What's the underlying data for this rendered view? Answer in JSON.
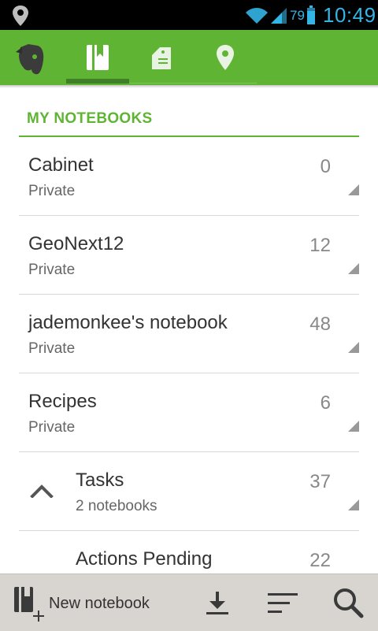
{
  "status_bar": {
    "battery_percent": "79",
    "time": "10:49",
    "icons": [
      "location-icon",
      "wifi-icon",
      "signal-icon",
      "battery-icon"
    ]
  },
  "header": {
    "logo": "evernote-elephant-icon",
    "tabs": [
      {
        "icon": "notebook-icon",
        "active": true
      },
      {
        "icon": "tag-icon",
        "active": false
      },
      {
        "icon": "map-pin-icon",
        "active": false
      }
    ],
    "accent_color": "#5fb533"
  },
  "section": {
    "title": "MY NOTEBOOKS"
  },
  "notebooks": [
    {
      "name": "Cabinet",
      "sub": "Private",
      "count": "0"
    },
    {
      "name": "GeoNext12",
      "sub": "Private",
      "count": "12"
    },
    {
      "name": "jademonkee's notebook",
      "sub": "Private",
      "count": "48"
    },
    {
      "name": "Recipes",
      "sub": "Private",
      "count": "6"
    },
    {
      "name": "Tasks",
      "sub": "2 notebooks",
      "count": "37",
      "expanded": true
    },
    {
      "name": "Actions Pending",
      "sub": "",
      "count": "22"
    }
  ],
  "bottom_bar": {
    "new_notebook_label": "New notebook",
    "icons": [
      "new-notebook-icon",
      "download-icon",
      "sort-icon",
      "search-icon"
    ]
  }
}
